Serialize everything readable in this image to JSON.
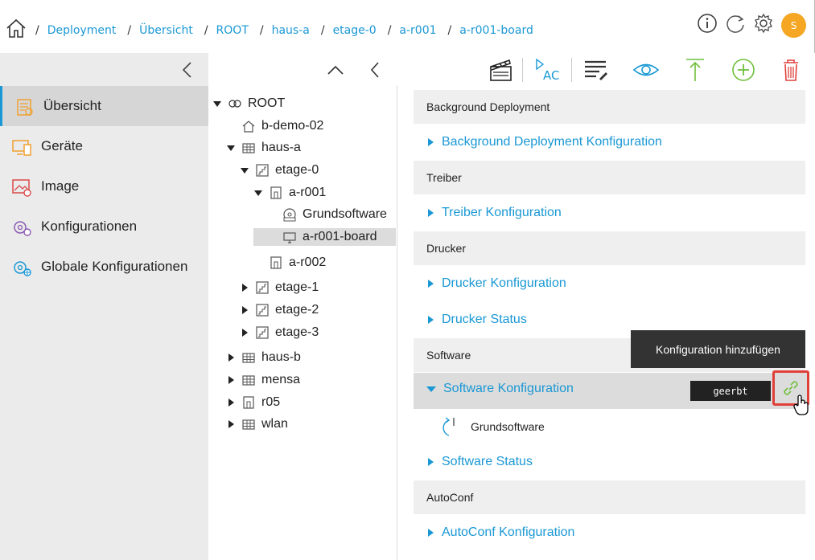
{
  "header": {
    "breadcrumbs": [
      "Deployment",
      "Übersicht",
      "ROOT",
      "haus-a",
      "etage-0",
      "a-r001",
      "a-r001-board"
    ],
    "separator": "/",
    "avatar_initial": "S"
  },
  "sidebar": {
    "items": [
      {
        "label": "Übersicht",
        "icon": "overview-icon",
        "active": true
      },
      {
        "label": "Geräte",
        "icon": "devices-icon",
        "active": false
      },
      {
        "label": "Image",
        "icon": "image-icon",
        "active": false
      },
      {
        "label": "Konfigurationen",
        "icon": "config-gear-icon",
        "active": false
      },
      {
        "label": "Globale Konfigurationen",
        "icon": "global-config-icon",
        "active": false
      }
    ]
  },
  "tree": {
    "nodes": [
      {
        "label": "ROOT",
        "level": 0,
        "expanded": true,
        "icon": "root-icon"
      },
      {
        "label": "b-demo-02",
        "level": 1,
        "expanded": null,
        "icon": "house-icon"
      },
      {
        "label": "haus-a",
        "level": 1,
        "expanded": true,
        "icon": "building-icon"
      },
      {
        "label": "etage-0",
        "level": 2,
        "expanded": true,
        "icon": "floor-icon"
      },
      {
        "label": "a-r001",
        "level": 3,
        "expanded": true,
        "icon": "room-icon"
      },
      {
        "label": "Grundsoftware",
        "level": 4,
        "expanded": null,
        "icon": "software-disc-icon"
      },
      {
        "label": "a-r001-board",
        "level": 4,
        "expanded": null,
        "icon": "monitor-icon",
        "selected": true
      },
      {
        "label": "a-r002",
        "level": 3,
        "expanded": null,
        "icon": "room-icon"
      },
      {
        "label": "etage-1",
        "level": 2,
        "expanded": false,
        "icon": "floor-icon"
      },
      {
        "label": "etage-2",
        "level": 2,
        "expanded": false,
        "icon": "floor-icon"
      },
      {
        "label": "etage-3",
        "level": 2,
        "expanded": false,
        "icon": "floor-icon"
      },
      {
        "label": "haus-b",
        "level": 1,
        "expanded": false,
        "icon": "building-icon"
      },
      {
        "label": "mensa",
        "level": 1,
        "expanded": false,
        "icon": "building-icon"
      },
      {
        "label": "r05",
        "level": 1,
        "expanded": false,
        "icon": "room-icon"
      },
      {
        "label": "wlan",
        "level": 1,
        "expanded": false,
        "icon": "building-icon"
      }
    ]
  },
  "panel": {
    "sections": [
      {
        "title": "Background Deployment",
        "items": [
          "Background Deployment Konfiguration"
        ]
      },
      {
        "title": "Treiber",
        "items": [
          "Treiber Konfiguration"
        ]
      },
      {
        "title": "Drucker",
        "items": [
          "Drucker Konfiguration",
          "Drucker Status"
        ]
      },
      {
        "title": "Software",
        "items": [
          "Software Konfiguration",
          "Software Status"
        ]
      },
      {
        "title": "AutoConf",
        "items": [
          "AutoConf Konfiguration"
        ]
      }
    ],
    "expanded_item": "Software Konfiguration",
    "inherited_badge": "geerbt",
    "sub_item": "Grundsoftware",
    "tooltip": "Konfiguration hinzufügen"
  },
  "colors": {
    "accent": "#1a98d5",
    "avatar": "#f5a623",
    "add_green": "#6fbf3a",
    "delete_red": "#e0403a",
    "highlight_border": "#e0403a"
  }
}
